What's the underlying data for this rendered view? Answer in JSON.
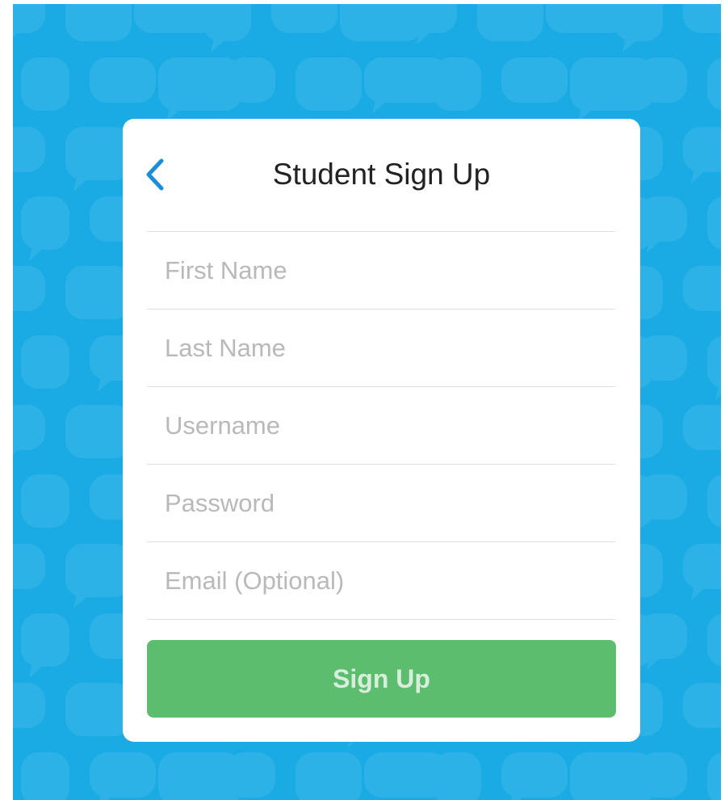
{
  "header": {
    "title": "Student Sign Up",
    "back_icon": "chevron-left-icon"
  },
  "form": {
    "fields": [
      {
        "name": "first-name",
        "placeholder": "First Name",
        "value": ""
      },
      {
        "name": "last-name",
        "placeholder": "Last Name",
        "value": ""
      },
      {
        "name": "username",
        "placeholder": "Username",
        "value": ""
      },
      {
        "name": "password",
        "placeholder": "Password",
        "value": ""
      },
      {
        "name": "email",
        "placeholder": "Email (Optional)",
        "value": ""
      }
    ],
    "submit_label": "Sign Up"
  },
  "colors": {
    "background": "#1aabe5",
    "pattern": "#3bb8ea",
    "accent": "#1a8fd6",
    "button": "#5dbd6e",
    "button_text": "#d6eedb"
  }
}
